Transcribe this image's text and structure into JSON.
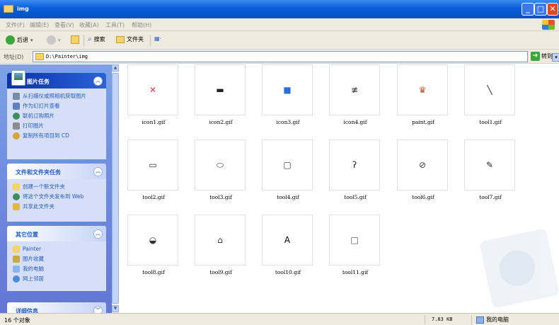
{
  "window": {
    "title": "img",
    "buttons": {
      "minimize": "_",
      "maximize": "□",
      "close": "✕"
    }
  },
  "menu": [
    "文件(F)",
    "编辑(E)",
    "查看(V)",
    "收藏(A)",
    "工具(T)",
    "帮助(H)"
  ],
  "toolbar": {
    "back": "后退",
    "search": "搜索",
    "folders": "文件夹",
    "views_icon": "▦·"
  },
  "address": {
    "label": "地址(D)",
    "path": "D:\\Painter\\img",
    "go": "转到"
  },
  "sidebar": {
    "picture_tasks": {
      "title": "图片任务",
      "items": [
        "从扫描仪或照相机获取图片",
        "作为幻灯片查看",
        "联机订购照片",
        "打印图片",
        "复制所有项目到 CD"
      ]
    },
    "file_tasks": {
      "title": "文件和文件夹任务",
      "items": [
        "创建一个新文件夹",
        "将这个文件夹发布到 Web",
        "共享此文件夹"
      ]
    },
    "other_places": {
      "title": "其它位置",
      "items": [
        "Painter",
        "图片收藏",
        "我的电脑",
        "网上邻居"
      ]
    },
    "details": {
      "title": "详细信息"
    }
  },
  "files": [
    {
      "name": "icon1.gif",
      "glyph": "✕",
      "color": "#d94040"
    },
    {
      "name": "icon2.gif",
      "glyph": "▬",
      "color": "#222222"
    },
    {
      "name": "icon3.gif",
      "glyph": "■",
      "color": "#2b6fd8"
    },
    {
      "name": "icon4.gif",
      "glyph": "≢",
      "color": "#333333"
    },
    {
      "name": "paint.gif",
      "glyph": "♛",
      "color": "#c0542a"
    },
    {
      "name": "tool1.gif",
      "glyph": "╲",
      "color": "#222222"
    },
    {
      "name": "tool2.gif",
      "glyph": "▭",
      "color": "#333333"
    },
    {
      "name": "tool3.gif",
      "glyph": "⬭",
      "color": "#333333"
    },
    {
      "name": "tool4.gif",
      "glyph": "▢",
      "color": "#333333"
    },
    {
      "name": "tool5.gif",
      "glyph": "ʔ",
      "color": "#222222"
    },
    {
      "name": "tool6.gif",
      "glyph": "⊘",
      "color": "#333333"
    },
    {
      "name": "tool7.gif",
      "glyph": "✎",
      "color": "#222222"
    },
    {
      "name": "tool8.gif",
      "glyph": "◒",
      "color": "#333333"
    },
    {
      "name": "tool9.gif",
      "glyph": "⌂",
      "color": "#333333"
    },
    {
      "name": "tool10.gif",
      "glyph": "A",
      "color": "#000000"
    },
    {
      "name": "tool11.gif",
      "glyph": "□",
      "color": "#444444"
    }
  ],
  "status": {
    "count": "16 个对象",
    "size": "7.83 KB",
    "location": "我的电脑"
  }
}
